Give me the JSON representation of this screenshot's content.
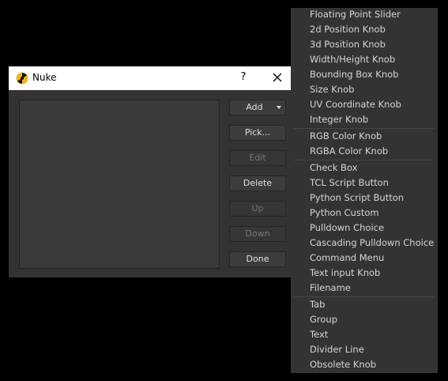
{
  "dialog": {
    "title": "Nuke",
    "help_label": "?",
    "buttons": {
      "add": "Add",
      "pick": "Pick...",
      "edit": "Edit",
      "delete": "Delete",
      "up": "Up",
      "down": "Down",
      "done": "Done"
    }
  },
  "menu": {
    "groups": [
      [
        "Floating Point Slider",
        "2d Position Knob",
        "3d Position Knob",
        "Width/Height Knob",
        "Bounding Box Knob",
        "Size Knob",
        "UV Coordinate Knob",
        "Integer Knob"
      ],
      [
        "RGB Color Knob",
        "RGBA Color Knob"
      ],
      [
        "Check Box",
        "TCL Script Button",
        "Python Script Button",
        "Python Custom",
        "Pulldown Choice",
        "Cascading Pulldown Choice",
        "Command Menu",
        "Text input Knob",
        "Filename"
      ],
      [
        "Tab",
        "Group",
        "Text",
        "Divider Line",
        "Obsolete Knob"
      ]
    ]
  },
  "colors": {
    "background": "#000000",
    "dialog_bg": "#333333",
    "menu_bg": "#333333",
    "text": "#d6d6d6",
    "disabled_text": "#777777"
  }
}
